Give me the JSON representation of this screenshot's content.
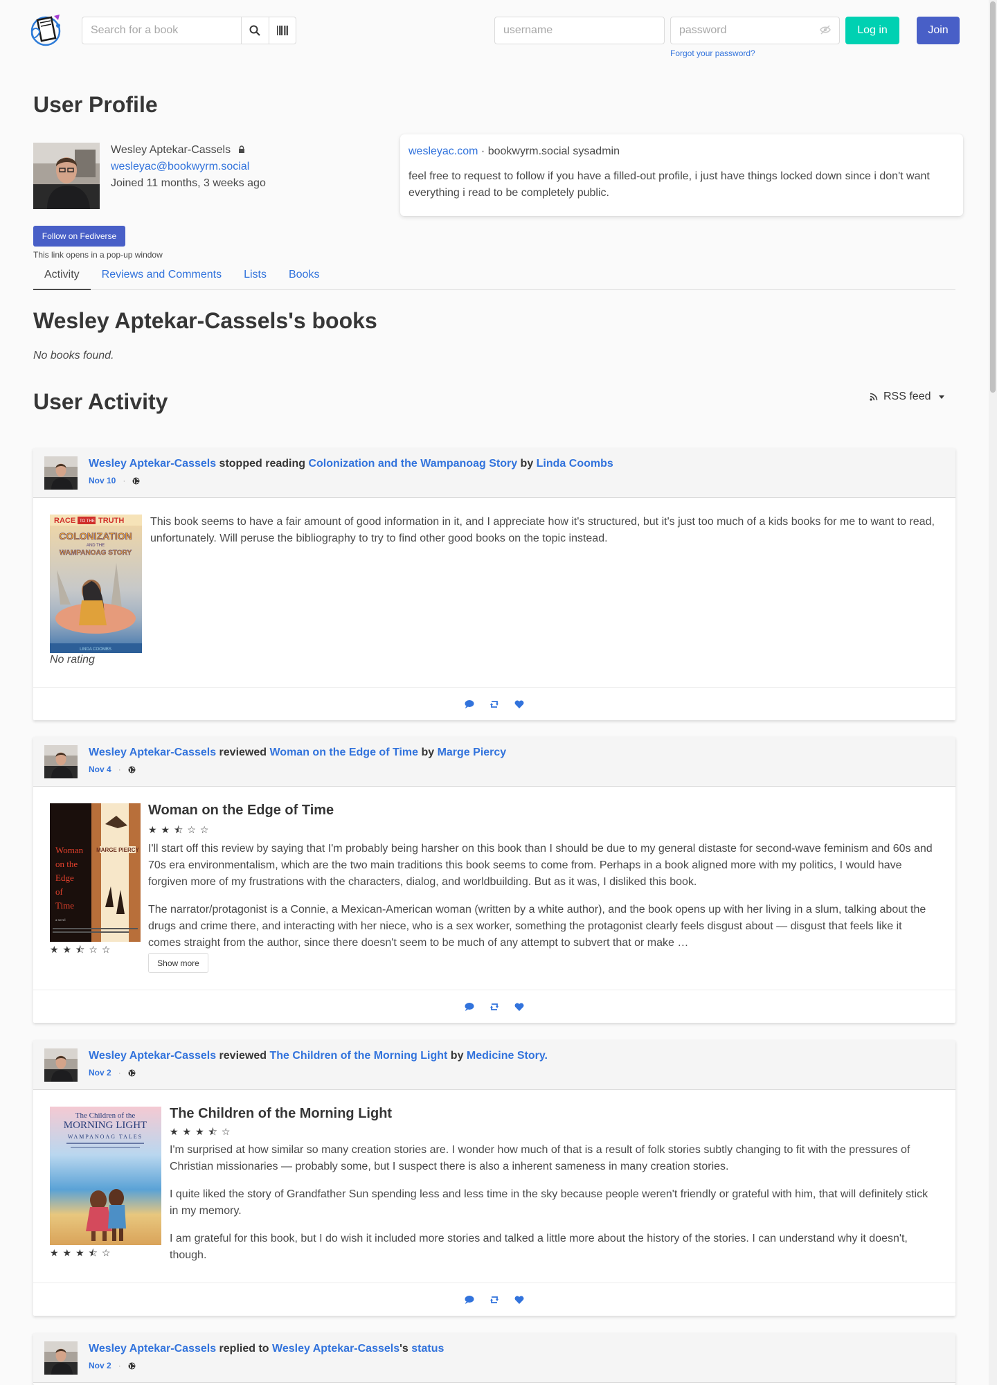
{
  "header": {
    "search_placeholder": "Search for a book",
    "username_placeholder": "username",
    "password_placeholder": "password",
    "login_label": "Log in",
    "join_label": "Join",
    "forgot_label": "Forgot your password?"
  },
  "profile": {
    "page_title": "User Profile",
    "name": "Wesley Aptekar-Cassels",
    "handle": "wesleyac@bookwyrm.social",
    "joined": "Joined 11 months, 3 weeks ago",
    "bio_link": "wesleyac.com",
    "bio_suffix": " · bookwyrm.social sysadmin",
    "bio_text": "feel free to request to follow if you have a filled-out profile, i just have things locked down since i don't want everything i read to be completely public.",
    "follow_label": "Follow on Fediverse",
    "popup_note": "This link opens in a pop-up window"
  },
  "tabs": [
    "Activity",
    "Reviews and Comments",
    "Lists",
    "Books"
  ],
  "books_section": {
    "title": "Wesley Aptekar-Cassels's books",
    "empty": "No books found."
  },
  "activity_section": {
    "title": "User Activity",
    "rss_label": "RSS feed"
  },
  "feed": [
    {
      "user": "Wesley Aptekar-Cassels",
      "verb": " stopped reading ",
      "book": "Colonization and the Wampanoag Story",
      "by": " by ",
      "author": "Linda Coombs",
      "date": "Nov 10",
      "text": "This book seems to have a fair amount of good information in it, and I appreciate how it's structured, but it's just too much of a kids books for me to want to read, unfortunately. Will peruse the bibliography to try to find other good books on the topic instead.",
      "rating_text": "No rating"
    },
    {
      "user": "Wesley Aptekar-Cassels",
      "verb": " reviewed ",
      "book": "Woman on the Edge of Time",
      "by": " by ",
      "author": "Marge Piercy",
      "date": "Nov 4",
      "review_title": "Woman on the Edge of Time",
      "rating": 2.5,
      "p1": "I'll start off this review by saying that I'm probably being harsher on this book than I should be due to my general distaste for second-wave feminism and 60s and 70s era environmentalism, which are the two main traditions this book seems to come from. Perhaps in a book aligned more with my politics, I would have forgiven more of my frustrations with the characters, dialog, and worldbuilding. But as it was, I disliked this book.",
      "p2": "The narrator/protagonist is a Connie, a Mexican-American woman (written by a white author), and the book opens up with her living in a slum, talking about the drugs and crime there, and interacting with her niece, who is a sex worker, something the protagonist clearly feels disgust about — disgust that feels like it comes straight from the author, since there doesn't seem to be much of any attempt to subvert that or make …",
      "show_more": "Show more"
    },
    {
      "user": "Wesley Aptekar-Cassels",
      "verb": " reviewed ",
      "book": "The Children of the Morning Light",
      "by": " by ",
      "author": "Medicine Story.",
      "date": "Nov 2",
      "review_title": "The Children of the Morning Light",
      "rating": 3.5,
      "p1": "I'm surprised at how similar so many creation stories are. I wonder how much of that is a result of folk stories subtly changing to fit with the pressures of Christian missionaries — probably some, but I suspect there is also a inherent sameness in many creation stories.",
      "p2": "I quite liked the story of Grandfather Sun spending less and less time in the sky because people weren't friendly or grateful with him, that will definitely stick in my memory.",
      "p3": "I am grateful for this book, but I do wish it included more stories and talked a little more about the history of the stories. I can understand why it doesn't, though."
    },
    {
      "user": "Wesley Aptekar-Cassels",
      "verb": " replied to ",
      "target_user": "Wesley Aptekar-Cassels",
      "possessive": "'s ",
      "target": "status",
      "date": "Nov 2"
    }
  ],
  "stars_display": {
    "two_half": "★★⯪☆☆",
    "three_half": "★★★⯪☆"
  },
  "colors": {
    "link": "#3273dc",
    "primary": "#485fc7",
    "success": "#00d1b2",
    "text": "#4a4a4a"
  },
  "covers": {
    "colonization": {
      "line1": "RACE",
      "line2": "TO THE",
      "line3": "TRUTH",
      "line4": "COLONIZATION",
      "line5": "AND THE",
      "line6": "WAMPANOAG STORY",
      "author": "LINDA COOMBS"
    },
    "woman": {
      "title_words": [
        "Woman",
        "on the",
        "Edge",
        "of",
        "Time"
      ],
      "author": "MARGE PIERCY",
      "tag": "a novel"
    },
    "children": {
      "line1": "The Children of the",
      "line2": "MORNING LIGHT",
      "line3": "WAMPANOAG TALES"
    }
  }
}
